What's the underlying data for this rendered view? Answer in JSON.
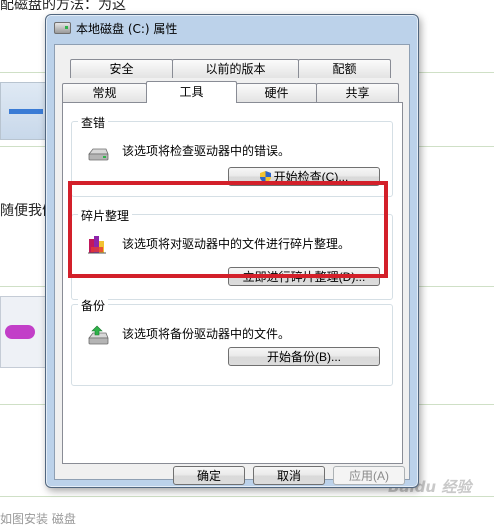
{
  "background": {
    "text_top": "配磁盘的方法：为这",
    "text_mid": "随便我们",
    "text_bottom": "如图安装 磁盘"
  },
  "watermark": "Baidu 经验",
  "window": {
    "title": "本地磁盘 (C:) 属性"
  },
  "tabs": {
    "row1": [
      "安全",
      "以前的版本",
      "配额"
    ],
    "row2": [
      "常规",
      "工具",
      "硬件",
      "共享"
    ],
    "active": "工具"
  },
  "groups": {
    "check": {
      "title": "查错",
      "description": "该选项将检查驱动器中的错误。",
      "button": "开始检查(C)..."
    },
    "defrag": {
      "title": "碎片整理",
      "description": "该选项将对驱动器中的文件进行碎片整理。",
      "button": "立即进行碎片整理(D)..."
    },
    "backup": {
      "title": "备份",
      "description": "该选项将备份驱动器中的文件。",
      "button": "开始备份(B)..."
    }
  },
  "footer": {
    "ok": "确定",
    "cancel": "取消",
    "apply": "应用(A)"
  },
  "colors": {
    "highlight": "#d3202a",
    "window_frame": "#bcd2ea"
  },
  "icons": [
    "drive-icon",
    "shield-icon",
    "defrag-icon",
    "backup-icon"
  ]
}
